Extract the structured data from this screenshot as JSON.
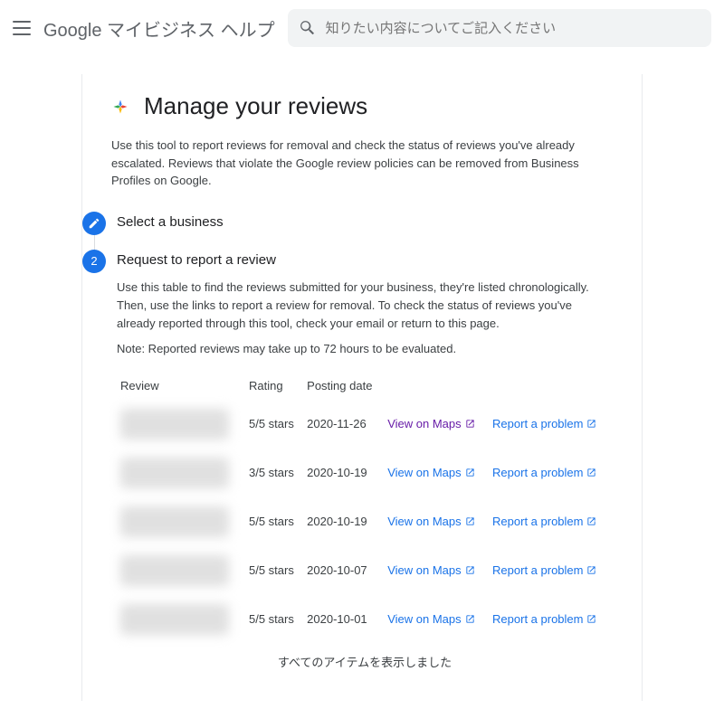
{
  "header": {
    "brand": "Google マイビジネス ヘルプ",
    "search_placeholder": "知りたい内容についてご記入ください"
  },
  "title": "Manage your reviews",
  "intro": "Use this tool to report reviews for removal and check the status of reviews you've already escalated. Reviews that violate the Google review policies can be removed from Business Profiles on Google.",
  "step1": {
    "title": "Select a business"
  },
  "step2": {
    "title": "Request to report a review",
    "body": "Use this table to find the reviews submitted for your business, they're listed chronologically. Then, use the links to report a review for removal. To check the status of reviews you've already reported through this tool, check your email or return to this page.",
    "note": "Note: Reported reviews may take up to 72 hours to be evaluated.",
    "columns": {
      "review": "Review",
      "rating": "Rating",
      "date": "Posting date"
    },
    "view_label": "View on Maps",
    "report_label": "Report a problem",
    "rows": [
      {
        "rating": "5/5 stars",
        "date": "2020-11-26",
        "visited": true
      },
      {
        "rating": "3/5 stars",
        "date": "2020-10-19",
        "visited": false
      },
      {
        "rating": "5/5 stars",
        "date": "2020-10-19",
        "visited": false
      },
      {
        "rating": "5/5 stars",
        "date": "2020-10-07",
        "visited": false
      },
      {
        "rating": "5/5 stars",
        "date": "2020-10-01",
        "visited": false
      }
    ],
    "all_shown": "すべてのアイテムを表示しました"
  }
}
